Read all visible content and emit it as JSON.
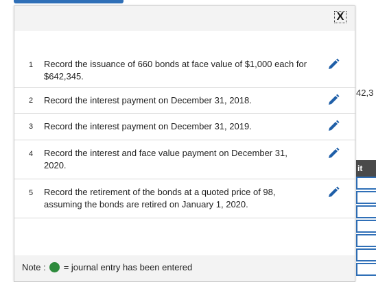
{
  "background": {
    "partial_value": "42,3",
    "partial_header": "it"
  },
  "modal": {
    "close_label": "X",
    "items": [
      {
        "num": "1",
        "text": "Record the issuance of 660 bonds at face value of $1,000 each for $642,345."
      },
      {
        "num": "2",
        "text": "Record the interest payment on December 31, 2018."
      },
      {
        "num": "3",
        "text": "Record the interest payment on December 31, 2019."
      },
      {
        "num": "4",
        "text": "Record the interest and face value payment on December 31, 2020."
      },
      {
        "num": "5",
        "text": "Record the retirement of the bonds at a quoted price of 98, assuming the bonds are retired on January 1, 2020."
      }
    ],
    "note": {
      "label": "Note :",
      "legend": "= journal entry has been entered"
    }
  },
  "colors": {
    "accent": "#2f6fb7",
    "entered_indicator": "#2e8b3d"
  },
  "icons": {
    "edit": "pencil-icon",
    "close": "close-icon"
  }
}
